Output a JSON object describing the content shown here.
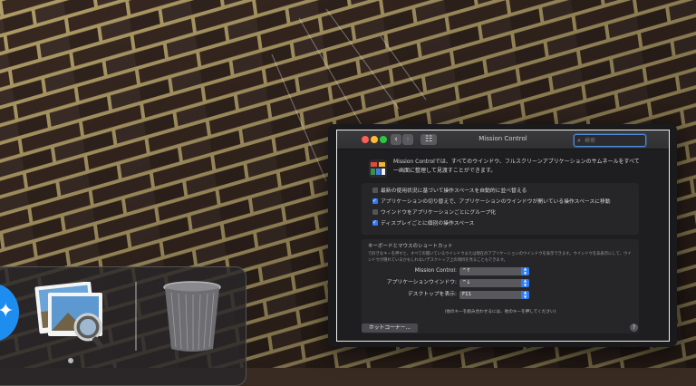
{
  "colors": {
    "accent": "#2f7cf6",
    "window_bg": "#1e1e20",
    "wallpaper_mortar": "#b9a56c",
    "wallpaper_brick": "#3b2a22"
  },
  "dock": {
    "apps": [
      {
        "name": "twitter-app-icon"
      },
      {
        "name": "preview-app-icon"
      },
      {
        "name": "trash-icon"
      }
    ]
  },
  "window": {
    "title": "Mission Control",
    "nav": {
      "back_glyph": "‹",
      "forward_glyph": "›",
      "grid_glyph": "☷"
    },
    "search": {
      "placeholder": "検索",
      "icon": "search-icon"
    },
    "description": "Mission Controlでは、すべてのウインドウ、フルスクリーンアプリケーションのサムネールをすべて一画面に整理して見渡すことができます。",
    "options": [
      {
        "label": "最新の使用状況に基づいて操作スペースを自動的に並べ替える",
        "checked": false
      },
      {
        "label": "アプリケーションの切り替えで、アプリケーションのウインドウが開いている操作スペースに移動",
        "checked": true
      },
      {
        "label": "ウインドウをアプリケーションごとにグループ化",
        "checked": false
      },
      {
        "label": "ディスプレイごとに個別の操作スペース",
        "checked": true
      }
    ],
    "shortcuts": {
      "heading": "キーボードとマウスのショートカット",
      "description": "で好きなキーを押すと、すべての開いているウインドウまたは現在のアプリケーションのウインドウを表示できます。ウインドウを非表示にして、ウインドウが隠れているかもしれないデスクトップ上の項目を見ることもできます。",
      "rows": [
        {
          "label": "Mission Control:",
          "value": "^↑"
        },
        {
          "label": "アプリケーションウインドウ:",
          "value": "^↓"
        },
        {
          "label": "デスクトップを表示:",
          "value": "F11"
        }
      ],
      "note": "(他のキーを組み合わせるには、他のキーを押してください)"
    },
    "hot_corners_label": "ホットコーナー...",
    "help_label": "?"
  }
}
